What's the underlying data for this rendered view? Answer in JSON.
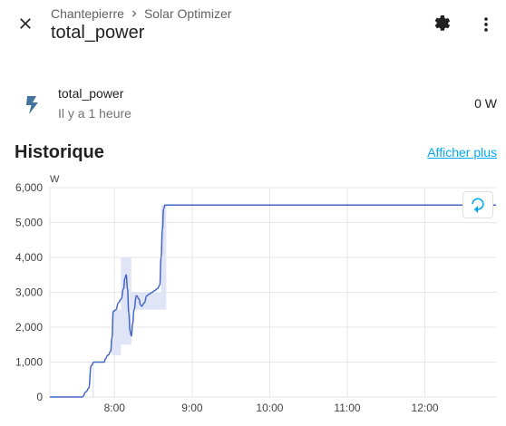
{
  "header": {
    "breadcrumb_area": "Chantepierre",
    "breadcrumb_device": "Solar Optimizer",
    "title": "total_power"
  },
  "entity": {
    "name": "total_power",
    "last_changed": "Il y a 1 heure",
    "value": "0 W",
    "icon": "flash-icon"
  },
  "history": {
    "title": "Historique",
    "show_more": "Afficher plus"
  },
  "colors": {
    "accent": "#03a9f4",
    "line": "#4565c4",
    "band": "#dfe5f6",
    "icon": "#44739e"
  },
  "chart_data": {
    "type": "line",
    "ylabel": "W",
    "ylim": [
      0,
      6000
    ],
    "yticks": [
      "0",
      "1,000",
      "2,000",
      "3,000",
      "4,000",
      "5,000",
      "6,000"
    ],
    "xlim": [
      "07:10",
      "12:55"
    ],
    "xticks": [
      "8:00",
      "9:00",
      "10:00",
      "11:00",
      "12:00"
    ],
    "grid": true,
    "series": [
      {
        "x": [
          "07:10",
          "07:35",
          "07:38",
          "07:40",
          "07:42",
          "07:44",
          "07:52",
          "07:53",
          "07:55",
          "07:57",
          "07:58",
          "07:59",
          "08:01",
          "08:03",
          "08:05",
          "08:07",
          "08:08",
          "08:09",
          "08:10",
          "08:11",
          "08:12",
          "08:13",
          "08:14",
          "08:15",
          "08:17",
          "08:19",
          "08:20",
          "08:21",
          "08:23",
          "08:25",
          "08:27",
          "08:29",
          "08:31",
          "08:33",
          "08:35",
          "08:36",
          "08:37",
          "08:38",
          "08:39",
          "08:40",
          "12:55"
        ],
        "values": [
          0,
          0,
          150,
          250,
          900,
          1000,
          1000,
          1100,
          1200,
          1300,
          1700,
          2450,
          2500,
          2700,
          2800,
          3100,
          3400,
          3500,
          3100,
          2400,
          1900,
          1750,
          2100,
          2500,
          2900,
          2800,
          2650,
          2600,
          2700,
          2900,
          2950,
          3000,
          3050,
          3100,
          3200,
          4000,
          4800,
          5400,
          5500,
          5500,
          5500
        ]
      }
    ],
    "band": [
      {
        "from": "07:43",
        "to": "07:44",
        "min": 0,
        "max": 1000
      },
      {
        "from": "07:58",
        "to": "08:05",
        "min": 1200,
        "max": 2500
      },
      {
        "from": "08:05",
        "to": "08:13",
        "min": 1500,
        "max": 4000
      },
      {
        "from": "08:13",
        "to": "08:18",
        "min": 2500,
        "max": 3000
      },
      {
        "from": "08:18",
        "to": "08:36",
        "min": 2500,
        "max": 3000
      },
      {
        "from": "08:36",
        "to": "08:40",
        "min": 2500,
        "max": 5500
      }
    ]
  }
}
